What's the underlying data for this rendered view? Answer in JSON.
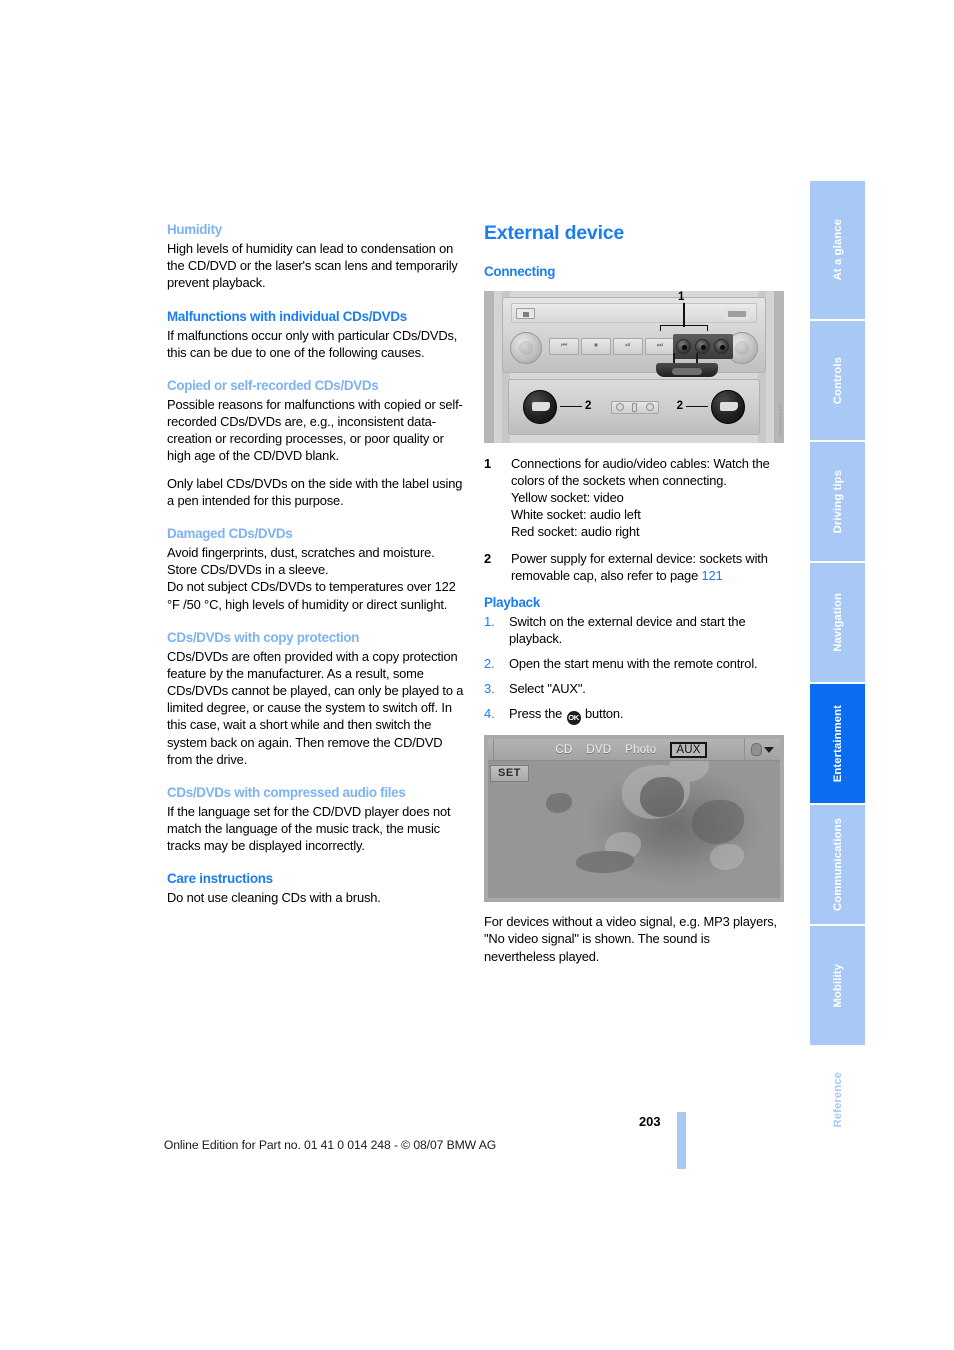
{
  "left_column": {
    "blocks": [
      {
        "type": "sub_heading",
        "text": "Humidity"
      },
      {
        "type": "paragraph",
        "text": "High levels of humidity can lead to condensation on the CD/DVD or the laser's scan lens and temporarily prevent playback."
      },
      {
        "type": "sect_heading",
        "text": "Malfunctions with individual CDs/DVDs"
      },
      {
        "type": "paragraph",
        "text": "If malfunctions occur only with particular CDs/DVDs, this can be due to one of the following causes."
      },
      {
        "type": "sub_heading",
        "text": "Copied or self-recorded CDs/DVDs"
      },
      {
        "type": "paragraph",
        "text": "Possible reasons for malfunctions with copied or self-recorded CDs/DVDs are, e.g., inconsistent data-creation or recording processes, or poor quality or high age of the CD/DVD blank."
      },
      {
        "type": "paragraph",
        "text": "Only label CDs/DVDs on the side with the label using a pen intended for this purpose."
      },
      {
        "type": "sub_heading",
        "text": "Damaged CDs/DVDs"
      },
      {
        "type": "paragraph",
        "text": "Avoid fingerprints, dust, scratches and moisture."
      },
      {
        "type": "paragraph",
        "text": "Store CDs/DVDs in a sleeve."
      },
      {
        "type": "paragraph",
        "text": "Do not subject CDs/DVDs to temperatures over 122 °F /50 °C, high levels of humidity or direct sunlight."
      },
      {
        "type": "sub_heading",
        "text": "CDs/DVDs with copy protection"
      },
      {
        "type": "paragraph",
        "text": "CDs/DVDs are often provided with a copy protection feature by the manufacturer. As a result, some CDs/DVDs cannot be played, can only be played to a limited degree, or cause the system to switch off. In this case, wait a short while and then switch the system back on again. Then remove the CD/DVD from the drive."
      },
      {
        "type": "sub_heading",
        "text": "CDs/DVDs with compressed audio files"
      },
      {
        "type": "paragraph",
        "text": "If the language set for the CD/DVD player does not match the language of the music track, the music tracks may be displayed incorrectly."
      },
      {
        "type": "sect_heading",
        "text": "Care instructions"
      },
      {
        "type": "paragraph",
        "text": "Do not use cleaning CDs with a brush."
      }
    ]
  },
  "right_column": {
    "page_title": "External device",
    "connecting_heading": "Connecting",
    "console_figure": {
      "label_1": "1",
      "label_2_left": "2",
      "label_2_right": "2",
      "image_code": "WGEAE00045",
      "transport_buttons": [
        "⏮",
        "⏹",
        "⏯",
        "⏭"
      ]
    },
    "legend": [
      {
        "num": "1",
        "text": "Connections for audio/video cables: Watch the colors of the sockets when connecting.\nYellow socket: video\nWhite socket: audio left\nRed socket: audio right"
      },
      {
        "num": "2",
        "text_before": "Power supply for external device: sockets with removable cap, also refer to page ",
        "page_ref": "121"
      }
    ],
    "playback_heading": "Playback",
    "steps": [
      {
        "num": "1.",
        "text": "Switch on the external device and start the playback."
      },
      {
        "num": "2.",
        "text": "Open the start menu with the remote control."
      },
      {
        "num": "3.",
        "text": "Select \"AUX\"."
      },
      {
        "num": "4.",
        "text_before": "Press the ",
        "glyph": "OK",
        "text_after": " button."
      }
    ],
    "screen_figure": {
      "menu_items": [
        "CD",
        "DVD",
        "Photo",
        "AUX"
      ],
      "selected_menu_item": "AUX",
      "set_button": "SET",
      "image_code": "VZ1SERT0005"
    },
    "closing_paragraph": "For devices without a video signal, e.g. MP3 players, \"No video signal\" is shown. The sound is nevertheless played."
  },
  "sidebar": {
    "tabs": [
      {
        "label": "At a glance",
        "state": "inactive"
      },
      {
        "label": "Controls",
        "state": "inactive"
      },
      {
        "label": "Driving tips",
        "state": "inactive"
      },
      {
        "label": "Navigation",
        "state": "inactive"
      },
      {
        "label": "Entertainment",
        "state": "active"
      },
      {
        "label": "Communications",
        "state": "inactive"
      },
      {
        "label": "Mobility",
        "state": "inactive"
      },
      {
        "label": "Reference",
        "state": "last"
      }
    ]
  },
  "footer": {
    "page_number": "203",
    "edition": "Online Edition for Part no. 01 41 0 014 248 - © 08/07 BMW AG"
  },
  "colors": {
    "heading_blue": "#1a7ef0",
    "subheading_blue": "#7eb3f2",
    "tab_blue": "#a8c8f5",
    "tab_active_blue": "#0a6cf0"
  }
}
